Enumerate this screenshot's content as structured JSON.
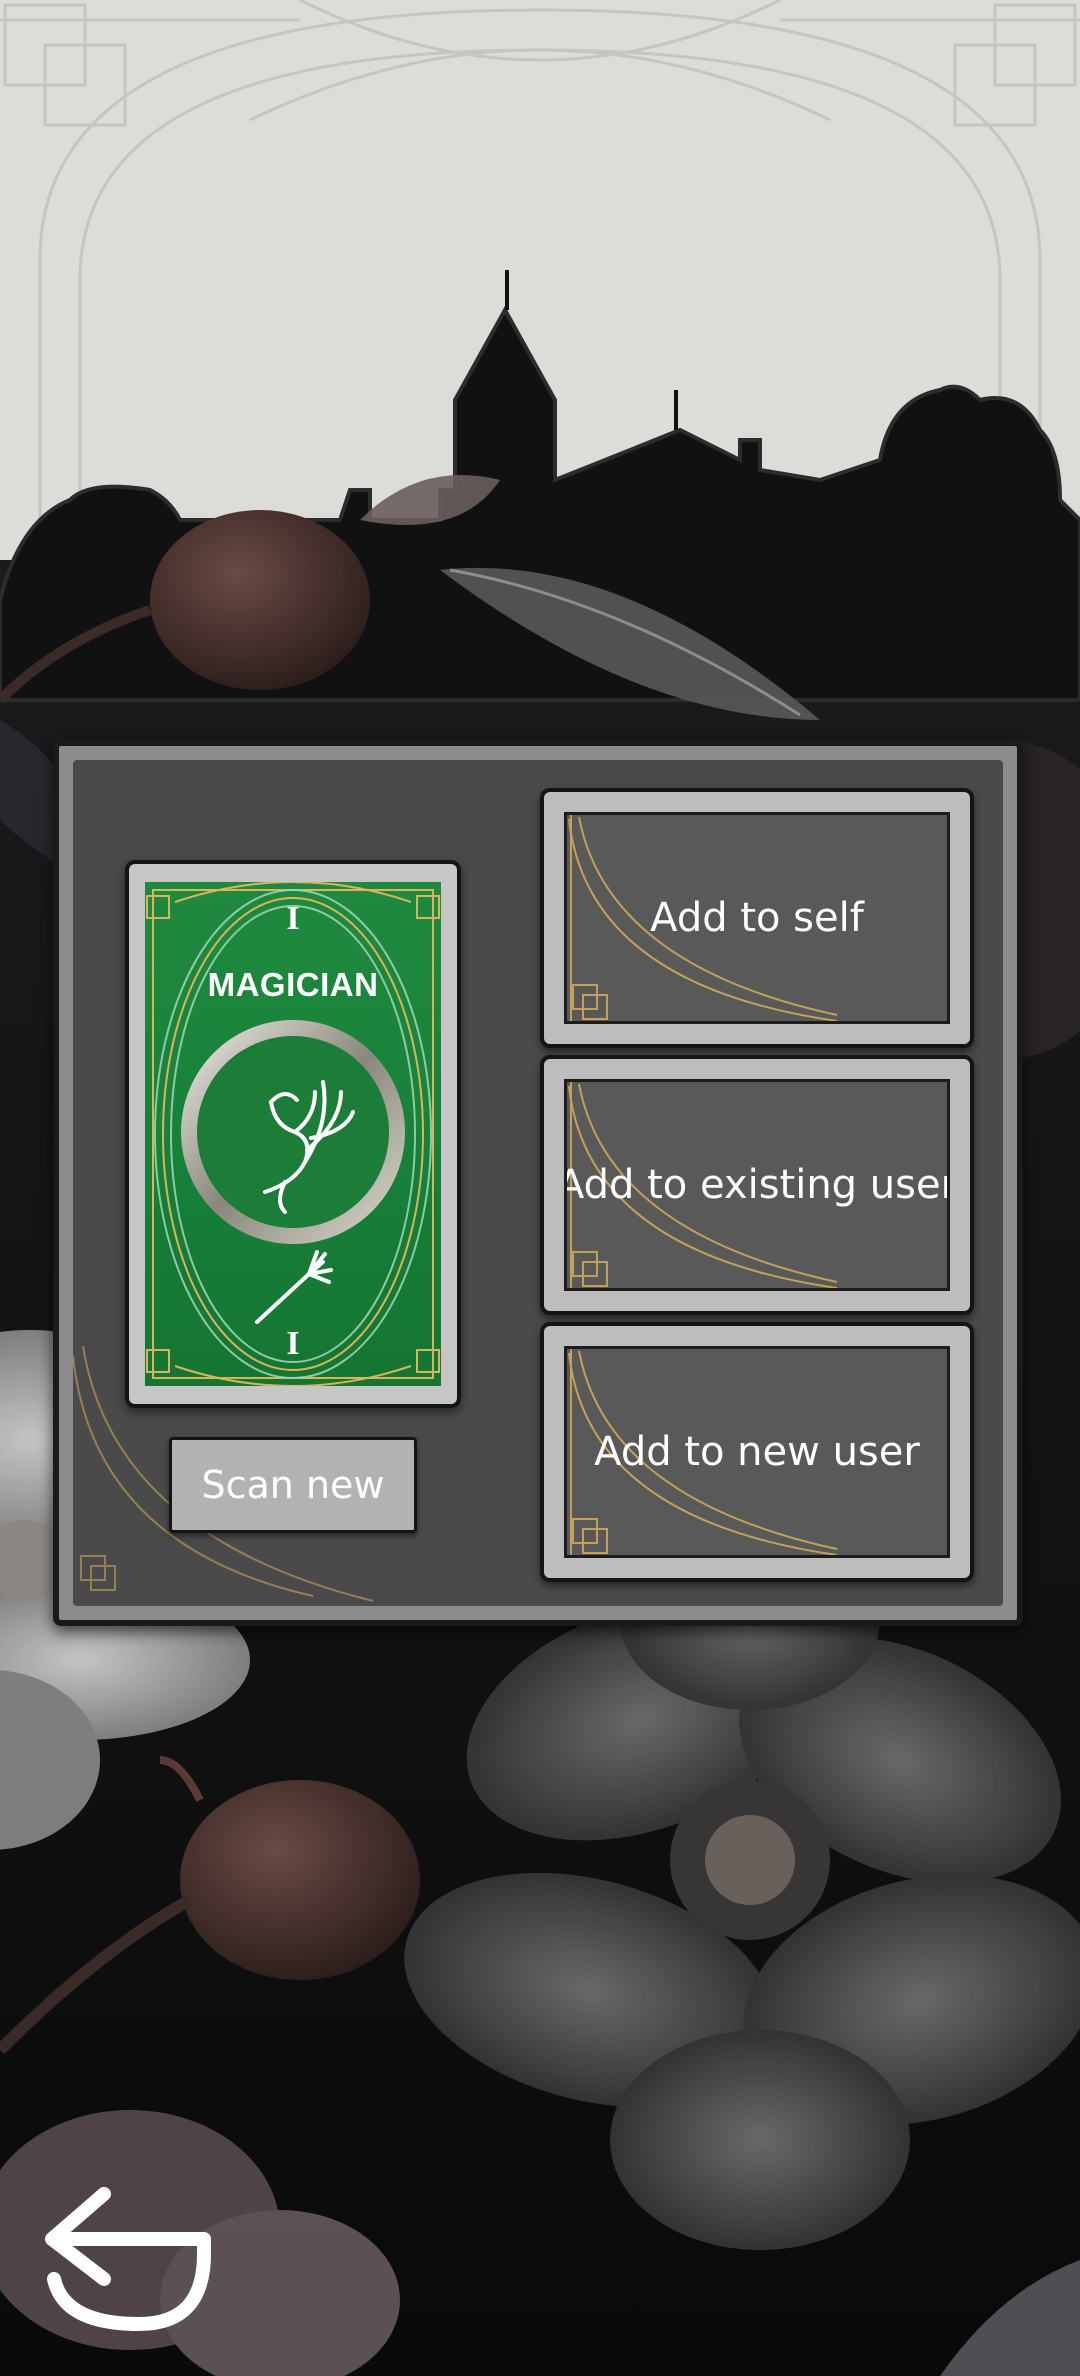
{
  "card": {
    "numeral_top": "I",
    "title": "MAGICIAN",
    "numeral_bottom": "I"
  },
  "buttons": {
    "scan_new": "Scan new",
    "add_to_self": "Add to self",
    "add_to_existing_user": "Add to existing user",
    "add_to_new_user": "Add to new user"
  },
  "icons": {
    "back": "back-arrow-icon",
    "card_emblem": "phoenix-icon",
    "wand": "magic-wand-icon"
  },
  "colors": {
    "card_green": "#1a843c",
    "card_gold": "#d9b45a",
    "button_gray": "#bdbdbd",
    "button_inner": "#595959"
  }
}
